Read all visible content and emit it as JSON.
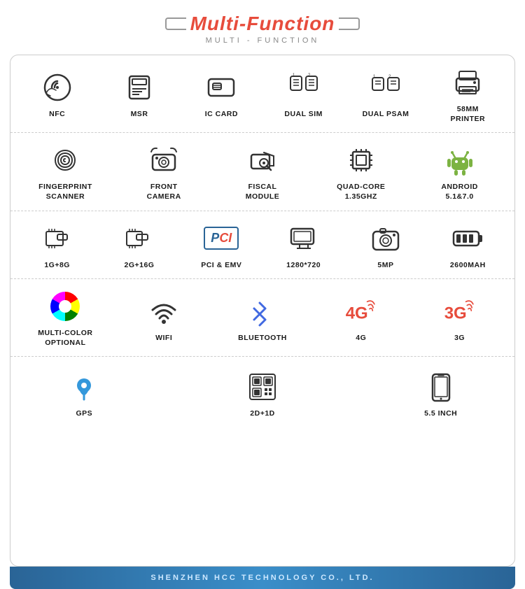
{
  "header": {
    "title_pre": "Multi-",
    "title_post": "Function",
    "subtitle": "MULTI - FUNCTION"
  },
  "rows": [
    {
      "id": "row1",
      "items": [
        {
          "id": "nfc",
          "label": "NFC"
        },
        {
          "id": "msr",
          "label": "MSR"
        },
        {
          "id": "ic_card",
          "label": "IC CARD"
        },
        {
          "id": "dual_sim",
          "label": "DUAL SIM"
        },
        {
          "id": "dual_psam",
          "label": "DUAL PSAM"
        },
        {
          "id": "printer",
          "label": "58MM\nPRINTER"
        }
      ]
    },
    {
      "id": "row2",
      "items": [
        {
          "id": "fingerprint",
          "label": "FINGERPRINT\nSCANNER"
        },
        {
          "id": "front_camera",
          "label": "FRONT\nCAMERA"
        },
        {
          "id": "fiscal",
          "label": "FISCAL\nMODULE"
        },
        {
          "id": "quad_core",
          "label": "QUAD-CORE\n1.35GHZ"
        },
        {
          "id": "android",
          "label": "ANDROID\n5.1&7.0"
        }
      ]
    },
    {
      "id": "row3",
      "items": [
        {
          "id": "mem1",
          "label": "1G+8G"
        },
        {
          "id": "mem2",
          "label": "2G+16G"
        },
        {
          "id": "pci",
          "label": "PCI & EMV"
        },
        {
          "id": "res",
          "label": "1280*720"
        },
        {
          "id": "camera5mp",
          "label": "5MP"
        },
        {
          "id": "battery",
          "label": "2600MAH"
        }
      ]
    },
    {
      "id": "row4",
      "items": [
        {
          "id": "multicolor",
          "label": "MULTI-COLOR\nOPTIONAL"
        },
        {
          "id": "wifi",
          "label": "WIFI"
        },
        {
          "id": "bluetooth",
          "label": "BLUETOOTH"
        },
        {
          "id": "4g",
          "label": "4G"
        },
        {
          "id": "3g",
          "label": "3G"
        }
      ]
    },
    {
      "id": "row5",
      "items": [
        {
          "id": "gps",
          "label": "GPS"
        },
        {
          "id": "2d1d",
          "label": "2D+1D"
        },
        {
          "id": "inch",
          "label": "5.5 INCH"
        }
      ]
    }
  ],
  "footer": {
    "text": "SHENZHEN  HCC  TECHNOLOGY  CO.,  LTD."
  }
}
